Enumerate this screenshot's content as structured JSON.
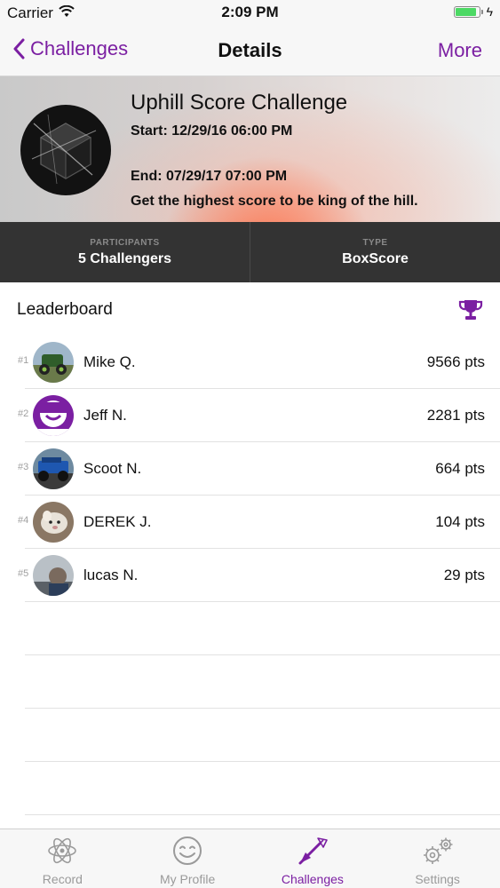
{
  "status_bar": {
    "carrier": "Carrier",
    "time": "2:09 PM",
    "battery_level": 0.9
  },
  "nav": {
    "back_label": "Challenges",
    "title": "Details",
    "more_label": "More"
  },
  "challenge": {
    "title": "Uphill Score Challenge",
    "start": "Start: 12/29/16 06:00 PM",
    "end": "End: 07/29/17 07:00 PM",
    "description": "Get the highest score to be king of the hill."
  },
  "stats": {
    "participants_label": "PARTICIPANTS",
    "participants_value": "5 Challengers",
    "type_label": "TYPE",
    "type_value": "BoxScore"
  },
  "leaderboard": {
    "title": "Leaderboard",
    "entries": [
      {
        "rank": "#1",
        "name": "Mike Q.",
        "points": "9566 pts"
      },
      {
        "rank": "#2",
        "name": "Jeff N.",
        "points": "2281 pts"
      },
      {
        "rank": "#3",
        "name": "Scoot N.",
        "points": "664 pts"
      },
      {
        "rank": "#4",
        "name": "DEREK J.",
        "points": "104 pts"
      },
      {
        "rank": "#5",
        "name": "lucas N.",
        "points": "29 pts"
      }
    ]
  },
  "tabs": [
    {
      "label": "Record",
      "icon": "atom-icon"
    },
    {
      "label": "My Profile",
      "icon": "smiley-icon"
    },
    {
      "label": "Challenges",
      "icon": "flag-icon",
      "active": true
    },
    {
      "label": "Settings",
      "icon": "gears-icon"
    }
  ],
  "colors": {
    "accent": "#7b1fa2",
    "stats_bg": "#333333",
    "battery": "#4cd964"
  }
}
